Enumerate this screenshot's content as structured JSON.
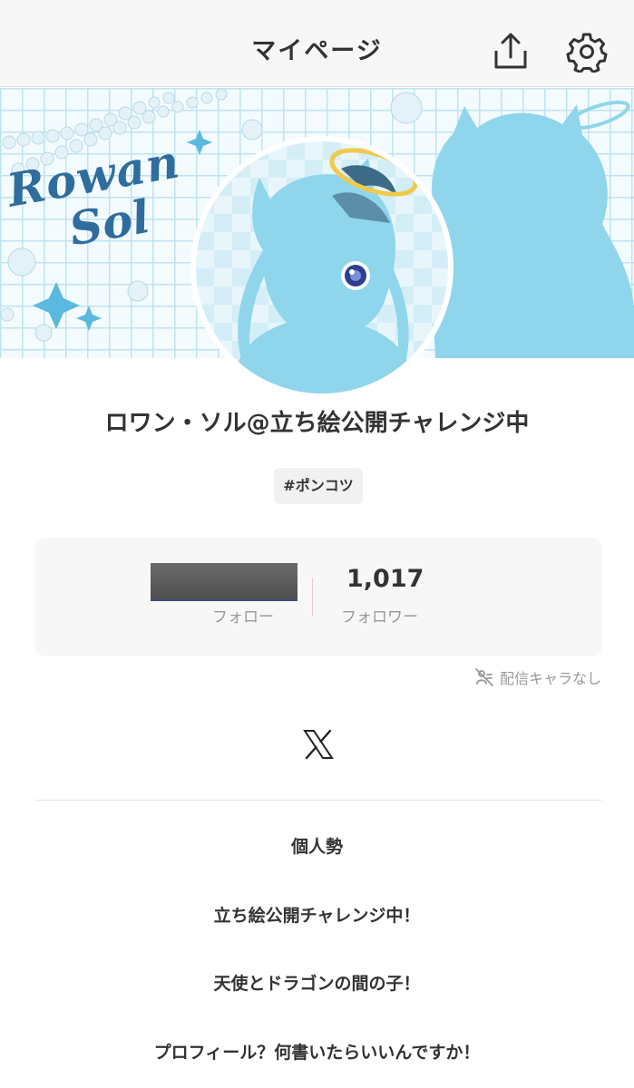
{
  "header": {
    "title": "マイページ",
    "share_icon": "share-icon",
    "settings_icon": "gear-icon"
  },
  "banner": {
    "logo_line1": "Rowan",
    "logo_line2": "Sol"
  },
  "profile": {
    "name": "ロワン・ソル@立ち絵公開チャレンジ中",
    "tag": "#ポンコツ"
  },
  "stats": {
    "follow_label": "フォロー",
    "follower_count": "1,017",
    "follower_label": "フォロワー"
  },
  "stream": {
    "status": "配信キャラなし",
    "icon": "no-character-icon"
  },
  "links": {
    "x_icon": "x-logo-icon"
  },
  "bio": [
    "個人勢",
    "立ち絵公開チャレンジ中！",
    "天使とドラゴンの間の子！",
    "プロフィール？何書いたらいいんですか！"
  ],
  "colors": {
    "banner_bg": "#f3fbfe",
    "banner_grid": "#bfe3f0",
    "silhouette": "#8fd6ec",
    "logo": "#2f6d9e",
    "text": "#333333",
    "subtext": "#999999"
  }
}
